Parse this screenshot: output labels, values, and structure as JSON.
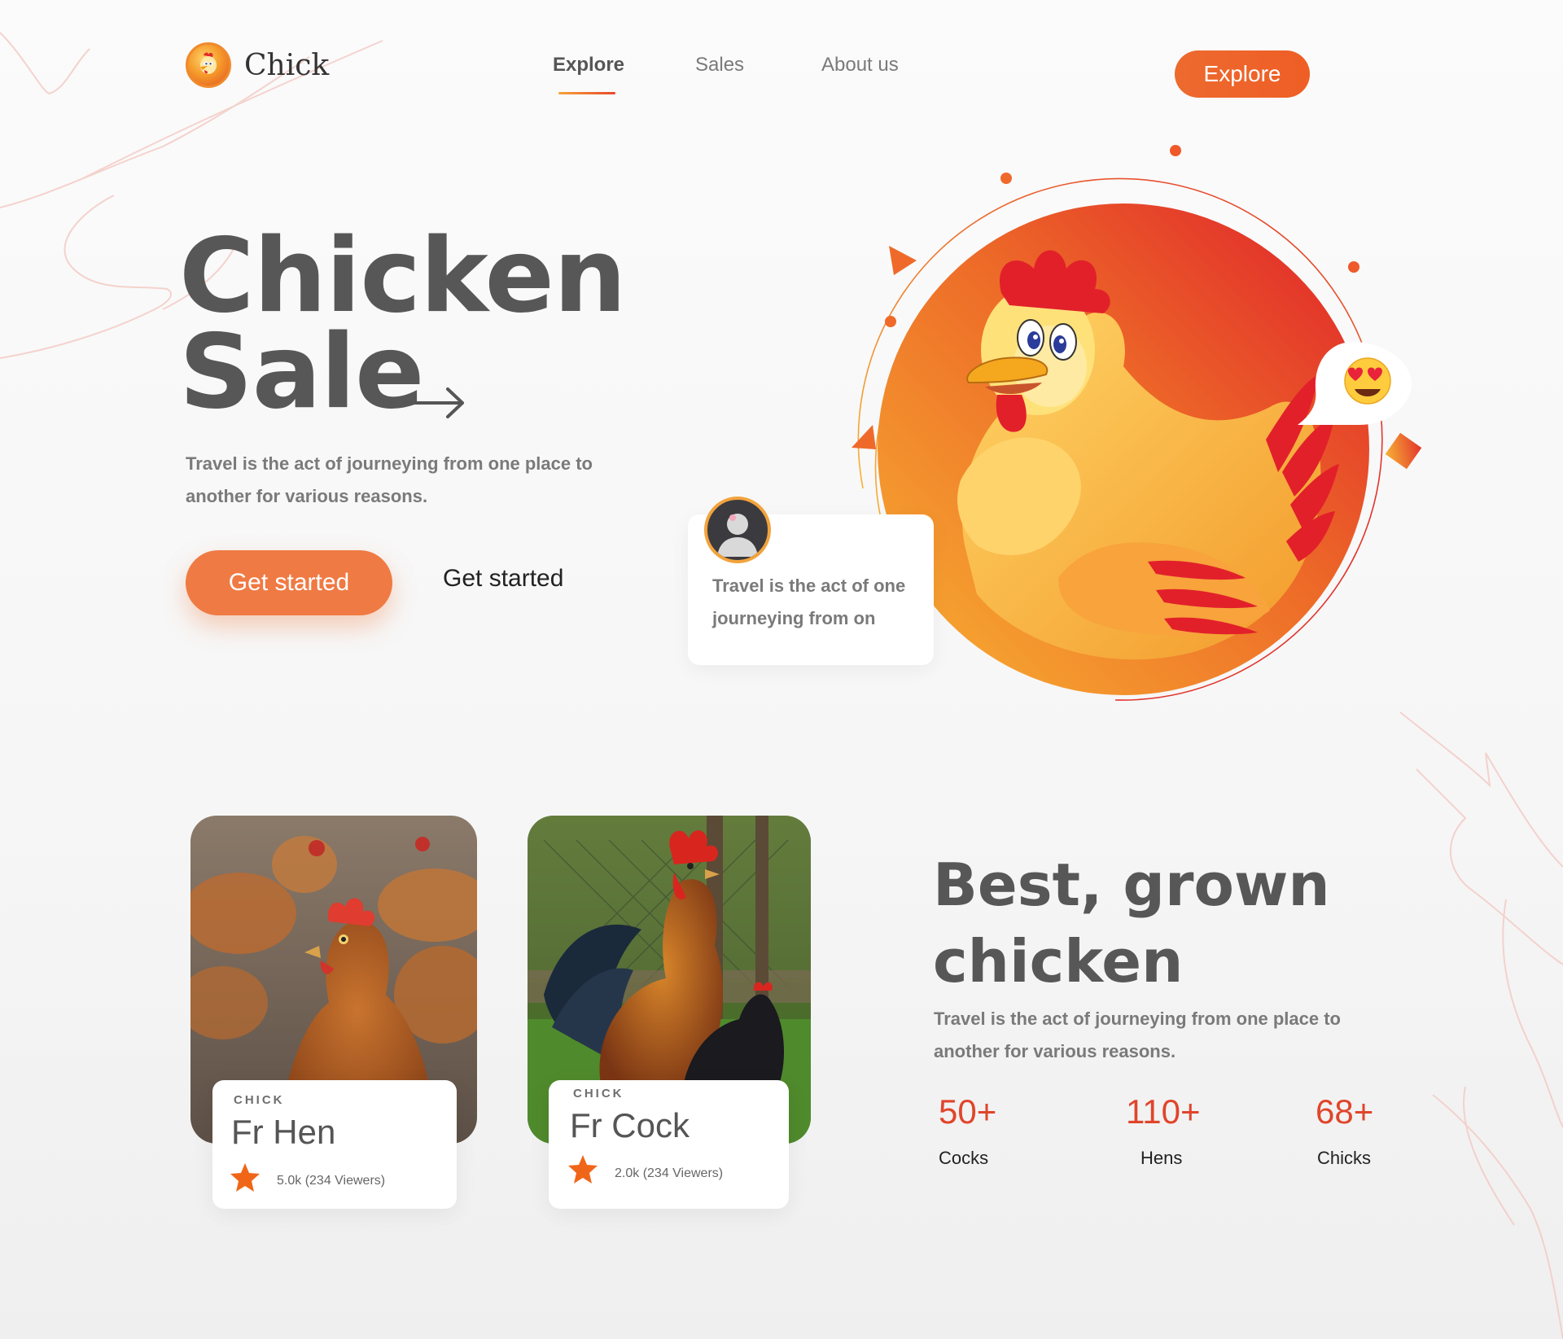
{
  "brand": {
    "name": "Chick"
  },
  "nav": {
    "items": [
      "Explore",
      "Sales",
      "About us"
    ],
    "cta_label": "Explore"
  },
  "hero": {
    "title_line1": "Chicken",
    "title_line2": "Sale",
    "subtitle": "Travel is the act of journeying from one place to another for various reasons.",
    "primary_label": "Get started",
    "secondary_label": "Get started"
  },
  "review": {
    "text": "Travel is the act of one journeying from on"
  },
  "cards": [
    {
      "kicker": "CHICK",
      "name": "Fr Hen",
      "meta": "5.0k (234 Viewers)"
    },
    {
      "kicker": "CHICK",
      "name": "Fr Cock",
      "meta": "2.0k (234 Viewers)"
    }
  ],
  "best": {
    "title_line1": "Best, grown",
    "title_line2": "chicken",
    "subtitle": "Travel is the act of journeying from one place to another for various reasons."
  },
  "stats": [
    {
      "value": "50+",
      "label": "Cocks"
    },
    {
      "value": "110+",
      "label": "Hens"
    },
    {
      "value": "68+",
      "label": "Chicks"
    }
  ],
  "colors": {
    "accent": "#ee6a2f",
    "accent_light": "#ef7a43",
    "stat_red": "#e0452b",
    "hero_circle_start": "#f59a2b",
    "hero_circle_end": "#e1252a"
  }
}
